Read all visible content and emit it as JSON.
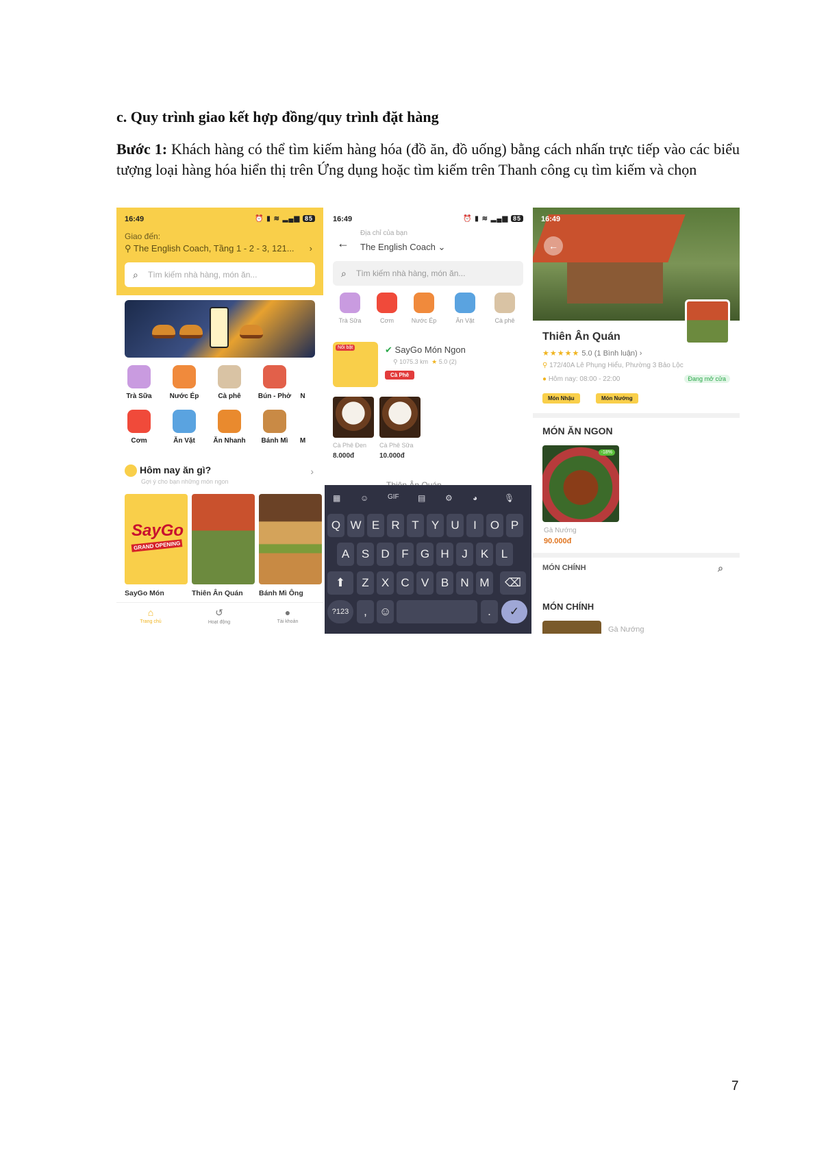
{
  "doc": {
    "heading": "c. Quy trình giao kết hợp đồng/quy trình đặt hàng",
    "step_label": "Bước 1:",
    "step_text": " Khách hàng có thể tìm kiếm hàng hóa (đồ ăn, đồ uống) bằng cách nhấn trực tiếp vào các biểu tượng loại hàng hóa hiển thị trên Ứng dụng hoặc tìm kiếm trên Thanh công cụ tìm kiếm và chọn",
    "page_number": "7"
  },
  "colors": {
    "brand_yellow": "#f9cf4a",
    "keyboard_bg": "#2f3142",
    "accent_green": "#2ba84a",
    "badge_red": "#e23c3c"
  },
  "screen1": {
    "time": "16:49",
    "battery": "85",
    "deliver_to_label": "Giao đến:",
    "address": "The English Coach, Tầng 1 - 2 - 3, 121...",
    "search_placeholder": "Tìm kiếm nhà hàng, món ăn...",
    "categories_row1": [
      "Trà Sữa",
      "Nước Ép",
      "Cà phê",
      "Bún - Phở",
      "N"
    ],
    "categories_row2": [
      "Cơm",
      "Ăn Vặt",
      "Ăn Nhanh",
      "Bánh Mì",
      "M"
    ],
    "suggest_title": "Hôm nay ăn gì?",
    "suggest_subtitle": "Gợi ý cho bạn những món ngon",
    "cards": [
      "SayGo Món",
      "Thiên Ân Quán",
      "Bánh Mì Ông"
    ],
    "saygo_logo": "SayGo",
    "saygo_sub": "GRAND OPENING",
    "tabs": [
      "Trang chủ",
      "Hoạt động",
      "Tài khoản"
    ]
  },
  "screen2": {
    "time": "16:49",
    "battery": "85",
    "address_label": "Địa chỉ của bạn",
    "address": "The English Coach",
    "search_placeholder": "Tìm kiếm nhà hàng, món ăn...",
    "categories": [
      "Trà Sữa",
      "Cơm",
      "Nước Ép",
      "Ăn Vặt",
      "Cà phê"
    ],
    "hot_tag": "Nổi bật",
    "shop_name": "SayGo Món Ngon",
    "shop_distance": "1075.3 km",
    "shop_rating": "5.0 (2)",
    "shop_badge": "Cà Phê",
    "products": [
      {
        "name": "Cà Phê Đen",
        "price": "8.000đ"
      },
      {
        "name": "Cà Phê Sữa",
        "price": "10.000đ"
      }
    ],
    "next_shop": "Thiên Ân Quán",
    "keyboard": {
      "row1": [
        "Q",
        "W",
        "E",
        "R",
        "T",
        "Y",
        "U",
        "I",
        "O",
        "P"
      ],
      "row2": [
        "A",
        "S",
        "D",
        "F",
        "G",
        "H",
        "J",
        "K",
        "L"
      ],
      "row3": [
        "Z",
        "X",
        "C",
        "V",
        "B",
        "N",
        "M"
      ],
      "gif": "GIF",
      "symbols": "?123",
      "comma": ",",
      "period": "."
    }
  },
  "screen3": {
    "time": "16:49",
    "name": "Thiên Ân Quán",
    "stars": "★★★★★",
    "rating": "5.0",
    "reviews": "(1 Bình luận)",
    "address": "172/40A Lê Phụng Hiểu, Phường 3 Bảo Lộc",
    "hours": "Hôm nay: 08:00 - 22:00",
    "open_status": "Đang mở cửa",
    "chips": [
      "Món Nhậu",
      "Món Nướng"
    ],
    "section_title": "MÓN ĂN NGON",
    "dish_discount": "-18%",
    "dish_name": "Gà Nướng",
    "dish_price": "90.000đ",
    "menu_bar": "MÓN CHÍNH",
    "section2_title": "MÓN CHÍNH",
    "bottom_item": "Gà Nướng"
  }
}
